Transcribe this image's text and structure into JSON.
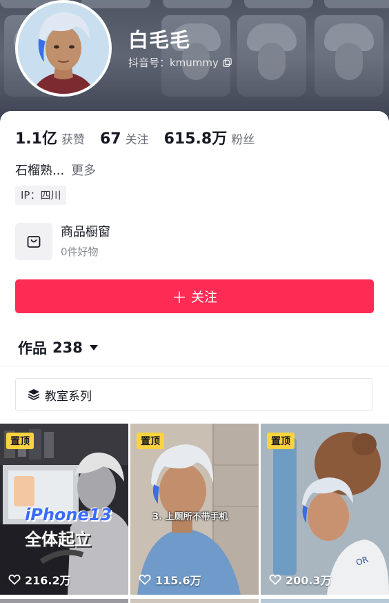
{
  "profile": {
    "nickname": "白毛毛",
    "douyin_id": "抖音号：kmummy"
  },
  "stats": [
    {
      "value": "1.1亿",
      "label": "获赞"
    },
    {
      "value": "67",
      "label": "关注"
    },
    {
      "value": "615.8万",
      "label": "粉丝"
    }
  ],
  "bio": {
    "text": "石榴熟...",
    "more": "更多"
  },
  "ip": "IP：四川",
  "shop": {
    "icon": "shopping-bag-icon",
    "title": "商品橱窗",
    "subtitle": "0件好物"
  },
  "follow_button": {
    "label": "关注",
    "icon": "plus-icon"
  },
  "works": {
    "label": "作品",
    "count": "238"
  },
  "collection": {
    "icon": "layers-icon",
    "label": "教室系列"
  },
  "videos": [
    {
      "pinned": "置顶",
      "likes": "216.2万",
      "caption_line1": "iPhone13",
      "caption_line2": "全体起立"
    },
    {
      "pinned": "置顶",
      "likes": "115.6万",
      "caption": "3. 上厕所不带手机"
    },
    {
      "pinned": "置顶",
      "likes": "200.3万"
    }
  ],
  "colors": {
    "accent": "#fe2c55",
    "pin_badge": "#fcd33d"
  }
}
